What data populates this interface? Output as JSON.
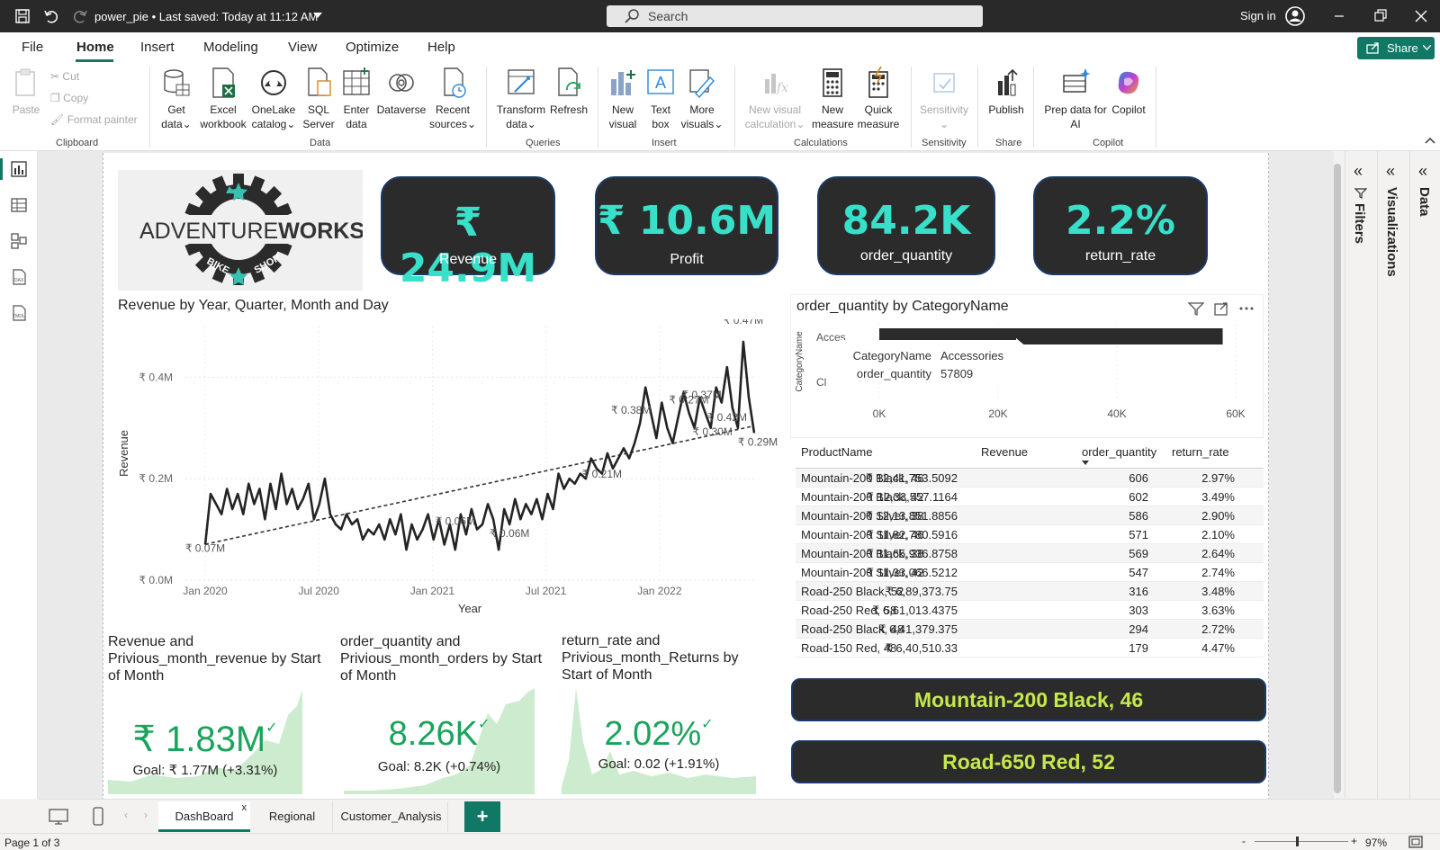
{
  "titlebar": {
    "title": "power_pie • Last saved: Today at 11:12 AM",
    "search_placeholder": "Search",
    "signin": "Sign in"
  },
  "menu": {
    "file": "File",
    "home": "Home",
    "insert": "Insert",
    "modeling": "Modeling",
    "view": "View",
    "optimize": "Optimize",
    "help": "Help",
    "share": "Share"
  },
  "ribbon": {
    "paste": "Paste",
    "cut": "Cut",
    "copy": "Copy",
    "format_painter": "Format painter",
    "clipboard": "Clipboard",
    "get_data": [
      "Get",
      "data"
    ],
    "excel": [
      "Excel",
      "workbook"
    ],
    "onelake": [
      "OneLake",
      "catalog"
    ],
    "sql": [
      "SQL",
      "Server"
    ],
    "enter": [
      "Enter",
      "data"
    ],
    "dataverse": [
      "Dataverse",
      ""
    ],
    "recent": [
      "Recent",
      "sources"
    ],
    "data": "Data",
    "transform": [
      "Transform",
      "data"
    ],
    "refresh": [
      "Refresh",
      ""
    ],
    "queries": "Queries",
    "new_visual": [
      "New",
      "visual"
    ],
    "text_box": [
      "Text",
      "box"
    ],
    "more_visuals": [
      "More",
      "visuals"
    ],
    "insert": "Insert",
    "new_visual_calc": [
      "New visual",
      "calculation"
    ],
    "new_measure": [
      "New",
      "measure"
    ],
    "quick_measure": [
      "Quick",
      "measure"
    ],
    "calculations": "Calculations",
    "sensitivity_btn": [
      "Sensitivity",
      ""
    ],
    "sensitivity": "Sensitivity",
    "publish": [
      "Publish",
      ""
    ],
    "share": "Share",
    "prep_data": [
      "Prep data for",
      "AI"
    ],
    "copilot_btn": [
      "Copilot",
      ""
    ],
    "copilot": "Copilot"
  },
  "panes": {
    "filters": "Filters",
    "visualizations": "Visualizations",
    "data": "Data"
  },
  "kpis": [
    {
      "value": "₹ 24.9M",
      "label": "Revenue"
    },
    {
      "value": "₹ 10.6M",
      "label": "Profit"
    },
    {
      "value": "84.2K",
      "label": "order_quantity"
    },
    {
      "value": "2.2%",
      "label": "return_rate"
    }
  ],
  "logo": {
    "text_a": "ADVENTURE",
    "text_b": "WORKS",
    "text_c": "BIKE",
    "text_d": "SHOP"
  },
  "line_chart": {
    "title": "Revenue by Year, Quarter, Month and Day",
    "xlabel": "Year",
    "ylabel": "Revenue",
    "ytick_labels": [
      "₹ 0.0M",
      "₹ 0.2M",
      "₹ 0.4M"
    ],
    "xtick_labels": [
      "Jan 2020",
      "Jul 2020",
      "Jan 2021",
      "Jul 2021",
      "Jan 2022"
    ],
    "annotations": [
      "₹ 0.07M",
      "₹ 0.06M",
      "₹ 0.06M",
      "₹ 0.21M",
      "₹ 0.38M",
      "₹ 0.27M",
      "₹ 0.37M",
      "₹ 0.30M",
      "₹ 0.42M",
      "₹ 0.47M",
      "₹ 0.29M"
    ]
  },
  "chart_data": [
    {
      "type": "line",
      "title": "Revenue by Year, Quarter, Month and Day",
      "xlabel": "Year",
      "ylabel": "Revenue",
      "ylim": [
        0,
        0.5
      ],
      "x_range": [
        "2020-01",
        "2022-06"
      ],
      "grid": true,
      "trendline": true,
      "series": [
        {
          "values": [
            0.07,
            0.17,
            0.15,
            0.13,
            0.18,
            0.14,
            0.17,
            0.13,
            0.19,
            0.15,
            0.18,
            0.12,
            0.19,
            0.14,
            0.21,
            0.15,
            0.18,
            0.14,
            0.16,
            0.19,
            0.12,
            0.15,
            0.2,
            0.13,
            0.11,
            0.1,
            0.13,
            0.11,
            0.12,
            0.08,
            0.1,
            0.09,
            0.11,
            0.08,
            0.12,
            0.09,
            0.13,
            0.06,
            0.11,
            0.08,
            0.1,
            0.13,
            0.08,
            0.12,
            0.07,
            0.11,
            0.06,
            0.13,
            0.09,
            0.14,
            0.1,
            0.11,
            0.15,
            0.12,
            0.06,
            0.14,
            0.11,
            0.16,
            0.12,
            0.15,
            0.13,
            0.16,
            0.12,
            0.17,
            0.14,
            0.21,
            0.18,
            0.2,
            0.19,
            0.21,
            0.2,
            0.24,
            0.22,
            0.21,
            0.25,
            0.22,
            0.24,
            0.26,
            0.24,
            0.27,
            0.31,
            0.38,
            0.33,
            0.28,
            0.35,
            0.3,
            0.27,
            0.32,
            0.37,
            0.33,
            0.3,
            0.36,
            0.33,
            0.3,
            0.38,
            0.35,
            0.42,
            0.34,
            0.3,
            0.47,
            0.36,
            0.29
          ]
        }
      ]
    },
    {
      "type": "bar",
      "title": "order_quantity by CategoryName",
      "ylabel": "CategoryName",
      "categories": [
        "Accessories",
        "Clothing"
      ],
      "values": [
        57809,
        0
      ],
      "xlim": [
        0,
        60000
      ],
      "xtick_labels": [
        "0K",
        "20K",
        "40K",
        "60K"
      ],
      "tooltip": {
        "CategoryName": "Accessories",
        "order_quantity": "57809"
      }
    }
  ],
  "bar_chart": {
    "title": "order_quantity by CategoryName",
    "category_short": [
      "Acces",
      "Cl"
    ],
    "tooltip_labels": [
      "CategoryName",
      "order_quantity"
    ],
    "tooltip_values": [
      "Accessories",
      "57809"
    ]
  },
  "table": {
    "headers": [
      "ProductName",
      "Revenue",
      "order_quantity",
      "return_rate"
    ],
    "rows": [
      [
        "Mountain-200 Black, 46",
        "₹ 12,41,753.5092",
        "606",
        "2.97%"
      ],
      [
        "Mountain-200 Black, 42",
        "₹ 12,33,557.1164",
        "602",
        "3.49%"
      ],
      [
        "Mountain-200 Silver, 38",
        "₹ 12,13,851.8856",
        "586",
        "2.90%"
      ],
      [
        "Mountain-200 Silver, 46",
        "₹ 11,82,780.5916",
        "571",
        "2.10%"
      ],
      [
        "Mountain-200 Black, 38",
        "₹ 11,65,936.8758",
        "569",
        "2.64%"
      ],
      [
        "Mountain-200 Silver, 42",
        "₹ 11,33,066.5212",
        "547",
        "2.74%"
      ],
      [
        "Road-250 Black, 52",
        "₹ 6,89,373.75",
        "316",
        "3.48%"
      ],
      [
        "Road-250 Red, 58",
        "₹ 6,61,013.4375",
        "303",
        "3.63%"
      ],
      [
        "Road-250 Black, 48",
        "₹ 6,41,379.375",
        "294",
        "2.72%"
      ],
      [
        "Road-150 Red, 48",
        "₹ 6,40,510.33",
        "179",
        "4.47%"
      ]
    ]
  },
  "product_cards": [
    "Mountain-200 Black, 46",
    "Road-650 Red, 52"
  ],
  "small_kpis": [
    {
      "title": "Revenue and Privious_month_revenue by Start of Month",
      "value": "₹ 1.83M",
      "goal": "Goal: ₹ 1.77M (+3.31%)"
    },
    {
      "title": "order_quantity and Privious_month_orders by Start of Month",
      "value": "8.26K",
      "goal": "Goal: 8.2K (+0.74%)"
    },
    {
      "title": "return_rate and Privious_month_Returns by Start of Month",
      "value": "2.02%",
      "goal": "Goal: 0.02 (+1.91%)"
    }
  ],
  "tabs": [
    "DashBoard",
    "Regional",
    "Customer_Analysis"
  ],
  "tab_close": "x",
  "tab_add": "+",
  "status": {
    "page": "Page 1 of 3",
    "zoom": "97%"
  },
  "colors": {
    "accent": "#117865",
    "kpi_bg": "#2b2b2b",
    "kpi_value": "#38e0c9",
    "card_text": "#c5e84a",
    "kpi_green": "#1aa35b",
    "sparkline": "#cdeccf"
  }
}
